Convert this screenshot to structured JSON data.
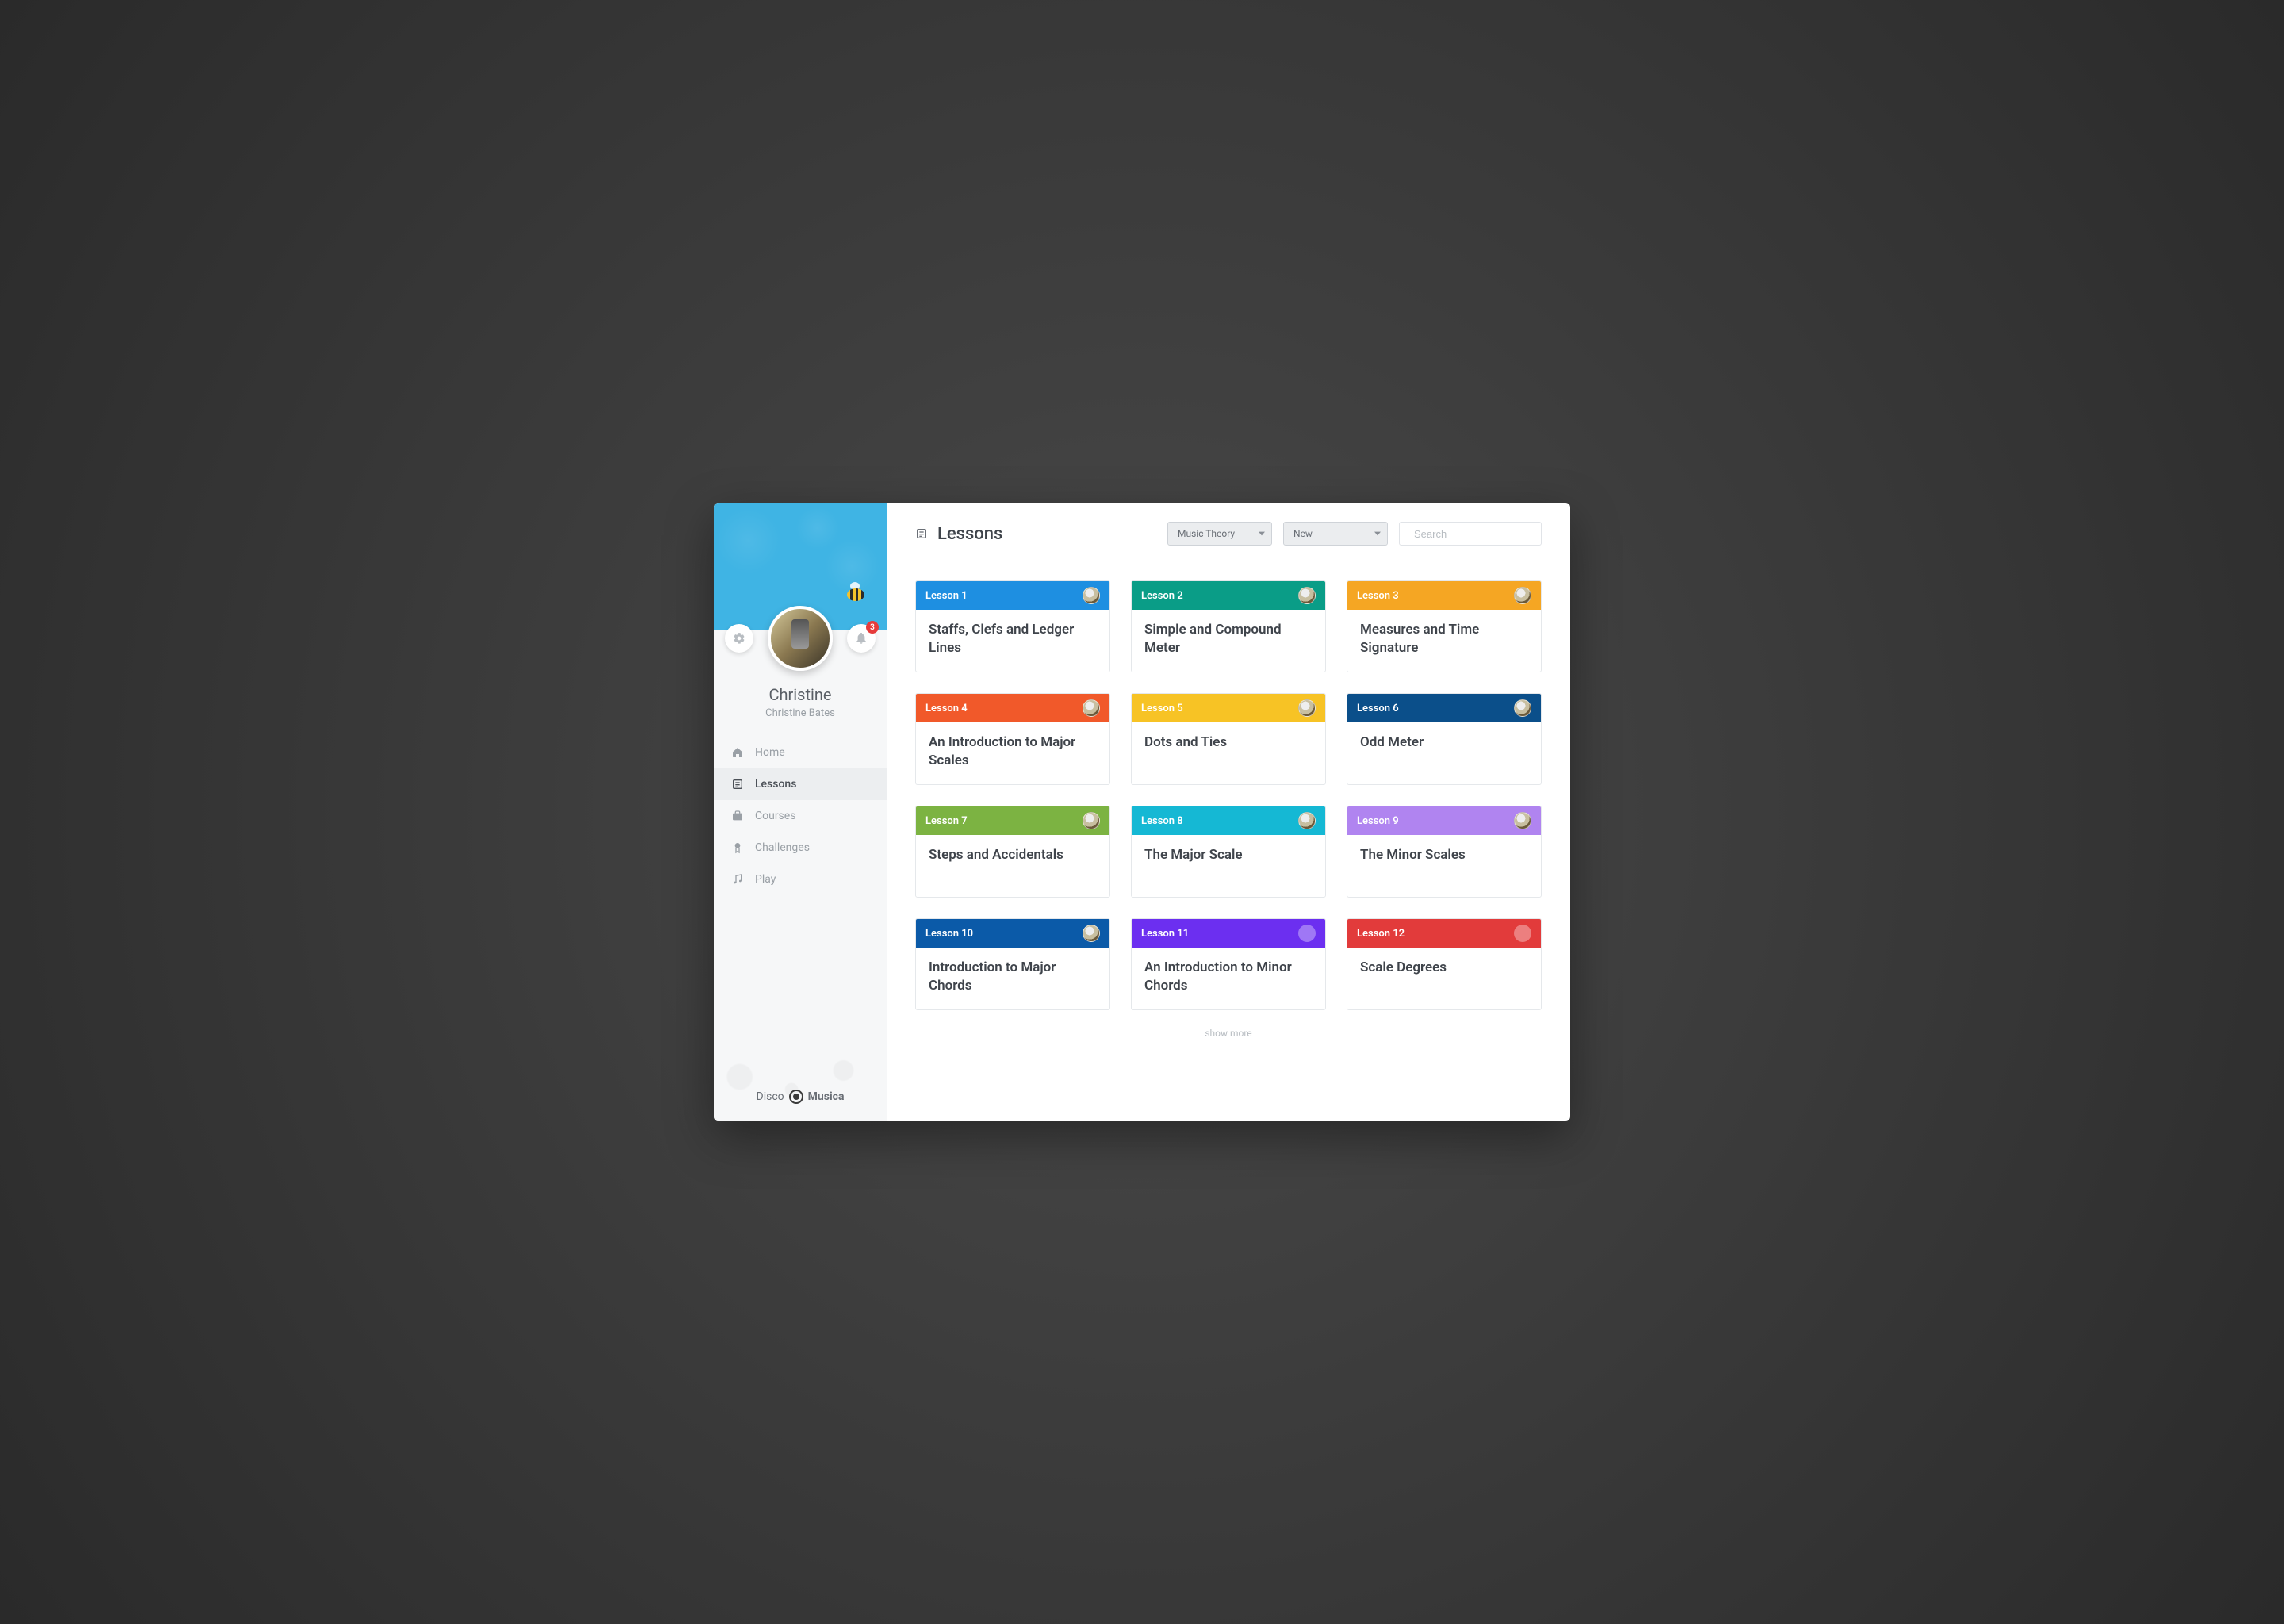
{
  "profile": {
    "first_name": "Christine",
    "full_name": "Christine Bates",
    "notification_count": "3"
  },
  "nav": {
    "items": [
      {
        "label": "Home",
        "icon": "home"
      },
      {
        "label": "Lessons",
        "icon": "list"
      },
      {
        "label": "Courses",
        "icon": "briefcase"
      },
      {
        "label": "Challenges",
        "icon": "badge"
      },
      {
        "label": "Play",
        "icon": "music"
      }
    ],
    "active_index": 1
  },
  "brand": {
    "prefix": "Disco",
    "suffix": "Musica"
  },
  "header": {
    "title": "Lessons",
    "filter_category": "Music Theory",
    "filter_sort": "New",
    "search_placeholder": "Search"
  },
  "lessons": [
    {
      "label": "Lesson 1",
      "title": "Staffs, Clefs and Ledger Lines",
      "color": "c-blue",
      "avatar": true
    },
    {
      "label": "Lesson 2",
      "title": "Simple and Compound Meter",
      "color": "c-teal",
      "avatar": true
    },
    {
      "label": "Lesson 3",
      "title": "Measures and Time Signature",
      "color": "c-amber",
      "avatar": true
    },
    {
      "label": "Lesson 4",
      "title": "An Introduction to Major Scales",
      "color": "c-orange",
      "avatar": true
    },
    {
      "label": "Lesson 5",
      "title": "Dots and Ties",
      "color": "c-yellow",
      "avatar": true
    },
    {
      "label": "Lesson 6",
      "title": "Odd Meter",
      "color": "c-navy",
      "avatar": true
    },
    {
      "label": "Lesson 7",
      "title": "Steps and Accidentals",
      "color": "c-green",
      "avatar": true
    },
    {
      "label": "Lesson 8",
      "title": "The Major Scale",
      "color": "c-cyan",
      "avatar": true
    },
    {
      "label": "Lesson 9",
      "title": "The Minor Scales",
      "color": "c-lilac",
      "avatar": true
    },
    {
      "label": "Lesson 10",
      "title": "Introduction to Major Chords",
      "color": "c-royal",
      "avatar": true
    },
    {
      "label": "Lesson 11",
      "title": "An Introduction to Minor Chords",
      "color": "c-purple",
      "avatar": false
    },
    {
      "label": "Lesson 12",
      "title": "Scale Degrees",
      "color": "c-red",
      "avatar": false
    }
  ],
  "show_more": "show more"
}
